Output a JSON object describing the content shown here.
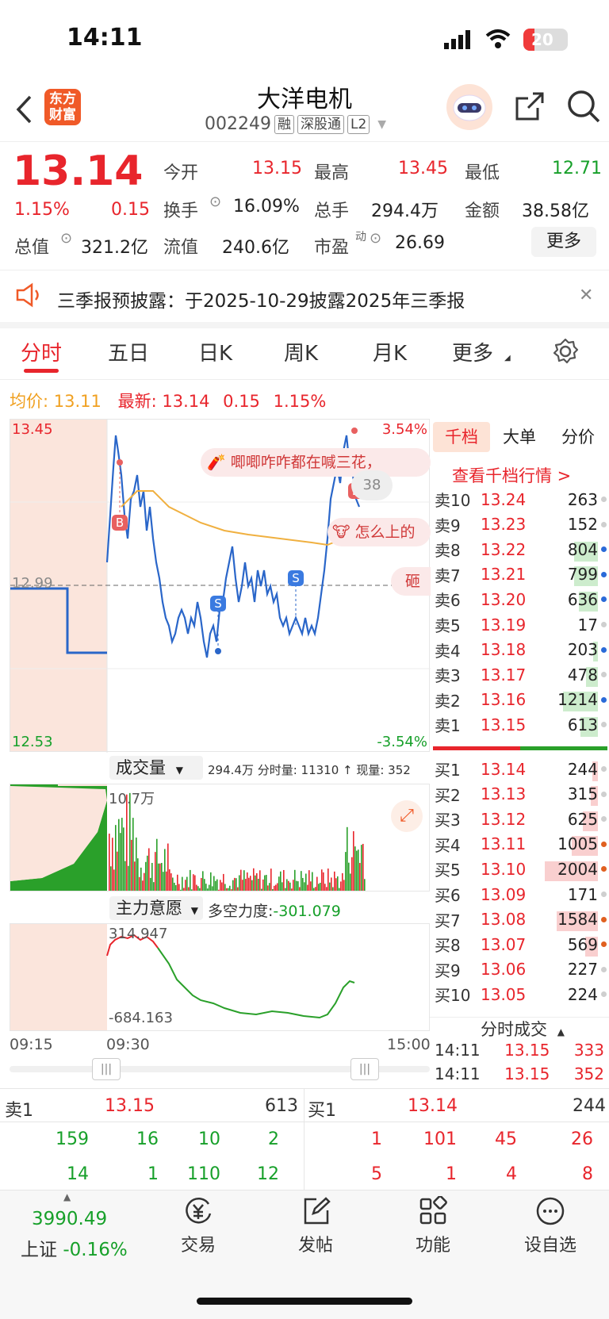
{
  "status": {
    "time": "14:11",
    "battery": "20"
  },
  "header": {
    "logo_line1": "东方",
    "logo_line2": "财富",
    "title": "大洋电机",
    "code": "002249",
    "tags": [
      "融",
      "深股通",
      "L2"
    ]
  },
  "quote": {
    "price": "13.14",
    "change_pct": "1.15%",
    "change": "0.15",
    "open_label": "今开",
    "open": "13.15",
    "high_label": "最高",
    "high": "13.45",
    "low_label": "最低",
    "low": "12.71",
    "turnover_label": "换手",
    "turnover": "16.09%",
    "volume_label": "总手",
    "volume": "294.4万",
    "amount_label": "金额",
    "amount": "38.58亿",
    "mcap_label": "总值",
    "mcap": "321.2亿",
    "float_label": "流值",
    "float": "240.6亿",
    "pe_label": "市盈",
    "pe_sup": "动",
    "pe": "26.69",
    "more_button": "更多"
  },
  "notice": {
    "text": "三季报预披露：于2025-10-29披露2025年三季报"
  },
  "tabs": [
    "分时",
    "五日",
    "日K",
    "周K",
    "月K",
    "更多"
  ],
  "chart_header": {
    "avg_label": "均价:",
    "avg": "13.11",
    "latest_label": "最新:",
    "latest": "13.14",
    "latest_change": "0.15",
    "latest_pct": "1.15%"
  },
  "intraday": {
    "y_top": "13.45",
    "y_bottom": "12.53",
    "y_mid": "12.99",
    "pct_top": "3.54%",
    "pct_bottom": "-3.54%",
    "bubble1": "唧唧咋咋都在喊三花，",
    "bubble2": "怎么上的",
    "bubble3": "砸",
    "bubble_count": "38",
    "marker_b": "B",
    "marker_s": "S"
  },
  "volume_panel": {
    "selector": "成交量",
    "summary": "294.4万 分时量: 11310 ↑ 现量: 352",
    "max_label": "10.7万"
  },
  "force_panel": {
    "selector": "主力意愿",
    "summary_label": "多空力度:",
    "summary_value": "-301.079",
    "top_label": "314.947",
    "bottom_label": "-684.163"
  },
  "time_axis": {
    "t0": "09:15",
    "t1": "09:30",
    "t2": "15:00"
  },
  "order_book": {
    "tabs": [
      "千档",
      "大单",
      "分价"
    ],
    "view_link": "查看千档行情 >",
    "asks": [
      {
        "label": "卖10",
        "price": "13.24",
        "vol": "263",
        "bar": 0.0,
        "dot": "#cfcfcf"
      },
      {
        "label": "卖9",
        "price": "13.23",
        "vol": "152",
        "bar": 0.0,
        "dot": "#cfcfcf"
      },
      {
        "label": "卖8",
        "price": "13.22",
        "vol": "804",
        "bar": 0.4,
        "dot": "#2a6ad8"
      },
      {
        "label": "卖7",
        "price": "13.21",
        "vol": "799",
        "bar": 0.4,
        "dot": "#2a6ad8"
      },
      {
        "label": "卖6",
        "price": "13.20",
        "vol": "636",
        "bar": 0.32,
        "dot": "#2a6ad8"
      },
      {
        "label": "卖5",
        "price": "13.19",
        "vol": "17",
        "bar": 0.0,
        "dot": "#cfcfcf"
      },
      {
        "label": "卖4",
        "price": "13.18",
        "vol": "203",
        "bar": 0.08,
        "dot": "#2a6ad8"
      },
      {
        "label": "卖3",
        "price": "13.17",
        "vol": "478",
        "bar": 0.2,
        "dot": "#cfcfcf"
      },
      {
        "label": "卖2",
        "price": "13.16",
        "vol": "1214",
        "bar": 0.6,
        "dot": "#2a6ad8"
      },
      {
        "label": "卖1",
        "price": "13.15",
        "vol": "613",
        "bar": 0.3,
        "dot": "#cfcfcf"
      }
    ],
    "bids": [
      {
        "label": "买1",
        "price": "13.14",
        "vol": "244",
        "bar": 0.1,
        "dot": "#cfcfcf"
      },
      {
        "label": "买2",
        "price": "13.13",
        "vol": "315",
        "bar": 0.12,
        "dot": "#cfcfcf"
      },
      {
        "label": "买3",
        "price": "13.12",
        "vol": "625",
        "bar": 0.25,
        "dot": "#cfcfcf"
      },
      {
        "label": "买4",
        "price": "13.11",
        "vol": "1005",
        "bar": 0.45,
        "dot": "#e06020"
      },
      {
        "label": "买5",
        "price": "13.10",
        "vol": "2004",
        "bar": 0.9,
        "dot": "#e06020"
      },
      {
        "label": "买6",
        "price": "13.09",
        "vol": "171",
        "bar": 0.0,
        "dot": "#cfcfcf"
      },
      {
        "label": "买7",
        "price": "13.08",
        "vol": "1584",
        "bar": 0.7,
        "dot": "#e06020"
      },
      {
        "label": "买8",
        "price": "13.07",
        "vol": "569",
        "bar": 0.22,
        "dot": "#e06020"
      },
      {
        "label": "买9",
        "price": "13.06",
        "vol": "227",
        "bar": 0.0,
        "dot": "#cfcfcf"
      },
      {
        "label": "买10",
        "price": "13.05",
        "vol": "224",
        "bar": 0.0,
        "dot": "#cfcfcf"
      }
    ],
    "ticks_title": "分时成交",
    "ticks": [
      {
        "time": "14:11",
        "price": "13.15",
        "vol": "333"
      },
      {
        "time": "14:11",
        "price": "13.15",
        "vol": "352"
      }
    ]
  },
  "levels": {
    "ask_label": "卖1",
    "ask_price": "13.15",
    "ask_vol": "613",
    "bid_label": "买1",
    "bid_price": "13.14",
    "bid_vol": "244",
    "ask_row1": [
      "159",
      "16",
      "10",
      "2"
    ],
    "ask_row2": [
      "14",
      "1",
      "110",
      "12"
    ],
    "bid_row1": [
      "1",
      "101",
      "45",
      "26"
    ],
    "bid_row2": [
      "5",
      "1",
      "4",
      "8"
    ]
  },
  "bottom_nav": {
    "index_value": "3990.49",
    "index_name": "上证",
    "index_pct": "-0.16%",
    "items": [
      "交易",
      "发帖",
      "功能",
      "设自选"
    ]
  }
}
